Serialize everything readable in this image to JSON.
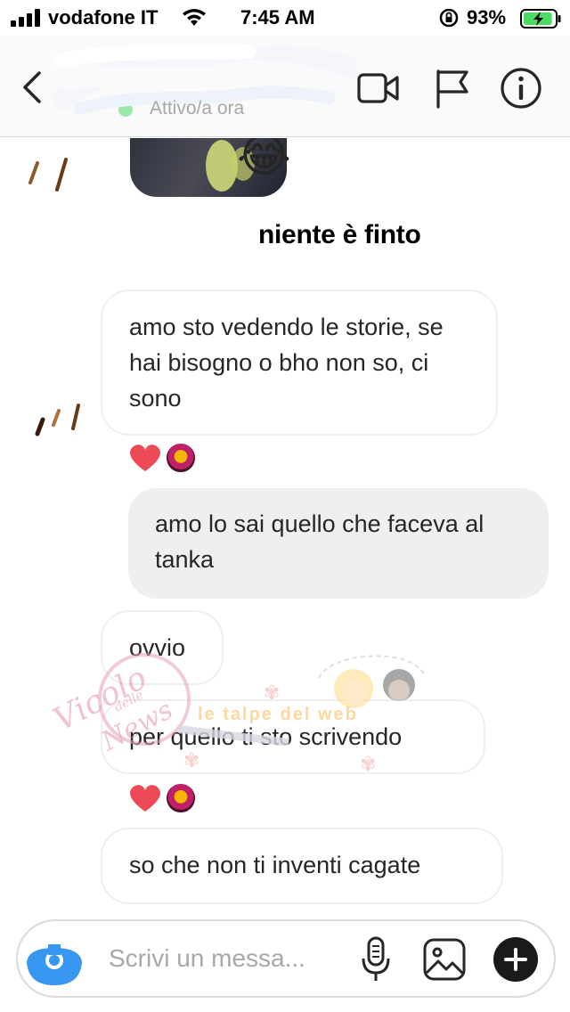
{
  "status_bar": {
    "carrier": "vodafone IT",
    "time": "7:45 AM",
    "battery_percent": "93%",
    "battery_level": 0.93,
    "battery_color": "#4cd964"
  },
  "header": {
    "activity": "Attivo/a ora",
    "icons": {
      "back": "chevron-left-icon",
      "video": "video-camera-icon",
      "flag": "flag-icon",
      "info": "info-icon"
    }
  },
  "story_reply": {
    "emoji": "😂",
    "caption": "niente è finto"
  },
  "messages": [
    {
      "direction": "in",
      "text": "amo sto vedendo le storie, se hai bisogno o bho non so, ci sono"
    },
    {
      "direction": "out",
      "text": "amo lo sai quello che faceva al tanka"
    },
    {
      "direction": "in",
      "text": "ovvio"
    },
    {
      "direction": "in",
      "text": "per quello ti sto scrivendo"
    },
    {
      "direction": "in",
      "text": "so che non ti inventi cagate"
    }
  ],
  "reactions": [
    {
      "after_message": 0,
      "emoji": "heart",
      "color": "#ed4956"
    },
    {
      "after_message": 3,
      "emoji": "heart",
      "color": "#ed4956"
    }
  ],
  "watermark": {
    "script": "Vicolo delle News",
    "banner": "le talpe del web"
  },
  "composer": {
    "placeholder": "Scrivi un messa...",
    "icons": {
      "camera": "camera-icon",
      "mic": "microphone-icon",
      "gallery": "image-gallery-icon",
      "plus": "plus-icon"
    }
  },
  "colors": {
    "incoming_border": "#efefef",
    "outgoing_bg": "#efefef",
    "camera_accent": "#3897f0",
    "placeholder": "#a8a8a8"
  }
}
